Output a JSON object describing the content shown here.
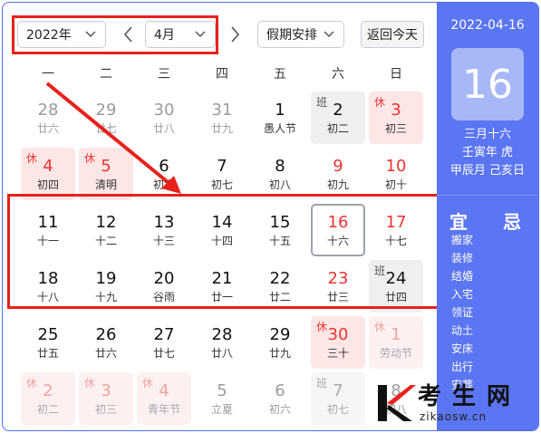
{
  "toolbar": {
    "year": "2022年",
    "month": "4月",
    "holiday": "假期安排",
    "today": "返回今天"
  },
  "weekdays": [
    "一",
    "二",
    "三",
    "四",
    "五",
    "六",
    "日"
  ],
  "days": [
    {
      "num": "28",
      "lunar": "廿六",
      "style": "gray",
      "tag": ""
    },
    {
      "num": "29",
      "lunar": "廿七",
      "style": "gray",
      "tag": ""
    },
    {
      "num": "30",
      "lunar": "廿八",
      "style": "gray",
      "tag": ""
    },
    {
      "num": "31",
      "lunar": "廿九",
      "style": "gray",
      "tag": ""
    },
    {
      "num": "1",
      "lunar": "愚人节",
      "style": "",
      "tag": ""
    },
    {
      "num": "2",
      "lunar": "初二",
      "style": "work",
      "tag": "班"
    },
    {
      "num": "3",
      "lunar": "初三",
      "style": "holiday",
      "tag": "休"
    },
    {
      "num": "4",
      "lunar": "初四",
      "style": "holiday",
      "tag": "休"
    },
    {
      "num": "5",
      "lunar": "清明",
      "style": "holiday",
      "tag": "休"
    },
    {
      "num": "6",
      "lunar": "初六",
      "style": "",
      "tag": ""
    },
    {
      "num": "7",
      "lunar": "初七",
      "style": "",
      "tag": ""
    },
    {
      "num": "8",
      "lunar": "初八",
      "style": "",
      "tag": ""
    },
    {
      "num": "9",
      "lunar": "初九",
      "style": "red",
      "tag": ""
    },
    {
      "num": "10",
      "lunar": "初十",
      "style": "red",
      "tag": ""
    },
    {
      "num": "11",
      "lunar": "十一",
      "style": "",
      "tag": ""
    },
    {
      "num": "12",
      "lunar": "十二",
      "style": "",
      "tag": ""
    },
    {
      "num": "13",
      "lunar": "十三",
      "style": "",
      "tag": ""
    },
    {
      "num": "14",
      "lunar": "十四",
      "style": "",
      "tag": ""
    },
    {
      "num": "15",
      "lunar": "十五",
      "style": "",
      "tag": ""
    },
    {
      "num": "16",
      "lunar": "十六",
      "style": "selected",
      "tag": ""
    },
    {
      "num": "17",
      "lunar": "十七",
      "style": "red",
      "tag": ""
    },
    {
      "num": "18",
      "lunar": "十八",
      "style": "",
      "tag": ""
    },
    {
      "num": "19",
      "lunar": "十九",
      "style": "",
      "tag": ""
    },
    {
      "num": "20",
      "lunar": "谷雨",
      "style": "",
      "tag": ""
    },
    {
      "num": "21",
      "lunar": "廿一",
      "style": "",
      "tag": ""
    },
    {
      "num": "22",
      "lunar": "廿二",
      "style": "",
      "tag": ""
    },
    {
      "num": "23",
      "lunar": "廿三",
      "style": "red",
      "tag": ""
    },
    {
      "num": "24",
      "lunar": "廿四",
      "style": "work",
      "tag": "班"
    },
    {
      "num": "25",
      "lunar": "廿五",
      "style": "",
      "tag": ""
    },
    {
      "num": "26",
      "lunar": "廿六",
      "style": "",
      "tag": ""
    },
    {
      "num": "27",
      "lunar": "廿七",
      "style": "",
      "tag": ""
    },
    {
      "num": "28",
      "lunar": "廿八",
      "style": "",
      "tag": ""
    },
    {
      "num": "29",
      "lunar": "廿九",
      "style": "",
      "tag": ""
    },
    {
      "num": "30",
      "lunar": "三十",
      "style": "holiday",
      "tag": "休"
    },
    {
      "num": "1",
      "lunar": "劳动节",
      "style": "faded-holiday",
      "tag": "休"
    },
    {
      "num": "2",
      "lunar": "初二",
      "style": "faded-holiday",
      "tag": "休"
    },
    {
      "num": "3",
      "lunar": "初三",
      "style": "faded-holiday",
      "tag": "休"
    },
    {
      "num": "4",
      "lunar": "青年节",
      "style": "faded-holiday",
      "tag": "休"
    },
    {
      "num": "5",
      "lunar": "立夏",
      "style": "gray",
      "tag": ""
    },
    {
      "num": "6",
      "lunar": "初六",
      "style": "gray",
      "tag": ""
    },
    {
      "num": "7",
      "lunar": "初七",
      "style": "faded-work",
      "tag": "班"
    },
    {
      "num": "8",
      "lunar": "初八",
      "style": "gray",
      "tag": ""
    }
  ],
  "side": {
    "date": "2022-04-16",
    "day": "16",
    "lunar_date": "三月十六",
    "year_ganzhi": "壬寅年 虎",
    "month_day_ganzhi": "甲辰月 己亥日",
    "yi_label": "宜",
    "ji_label": "忌",
    "yi_items": [
      "搬家",
      "装修",
      "结婚",
      "入宅",
      "领证",
      "动土",
      "安床",
      "出行",
      "安葬"
    ]
  },
  "watermark": {
    "cn": "考生网",
    "en": "zikaosw.cn"
  },
  "colors": {
    "accent": "#5b76f2",
    "holiday_red": "#ee3333",
    "annotation_red": "#e8211c"
  }
}
